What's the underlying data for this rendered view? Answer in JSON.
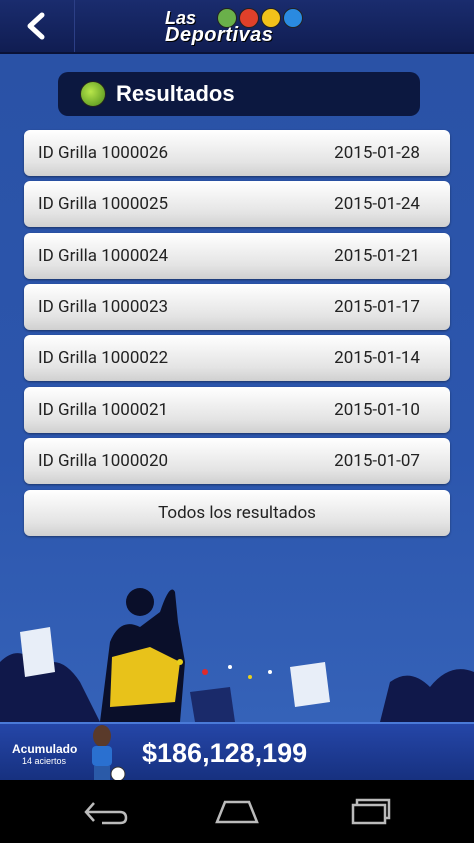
{
  "header": {
    "logo_line1": "Las",
    "logo_line2": "Deportivas"
  },
  "section": {
    "title": "Resultados"
  },
  "results": [
    {
      "id": "ID Grilla 1000026",
      "date": "2015-01-28"
    },
    {
      "id": "ID Grilla 1000025",
      "date": "2015-01-24"
    },
    {
      "id": "ID Grilla 1000024",
      "date": "2015-01-21"
    },
    {
      "id": "ID Grilla 1000023",
      "date": "2015-01-17"
    },
    {
      "id": "ID Grilla 1000022",
      "date": "2015-01-14"
    },
    {
      "id": "ID Grilla 1000021",
      "date": "2015-01-10"
    },
    {
      "id": "ID Grilla 1000020",
      "date": "2015-01-07"
    }
  ],
  "all_results_label": "Todos los resultados",
  "footer": {
    "accumulated_label": "Acumulado",
    "accumulated_sub": "14 aciertos",
    "amount": "$186,128,199"
  },
  "icons": {
    "back": "back-arrow-icon",
    "nav_back": "nav-back-icon",
    "nav_home": "nav-home-icon",
    "nav_recents": "nav-recents-icon"
  },
  "colors": {
    "background": "#2a4ea2",
    "header": "#101d52",
    "section_header": "#0c1840"
  }
}
